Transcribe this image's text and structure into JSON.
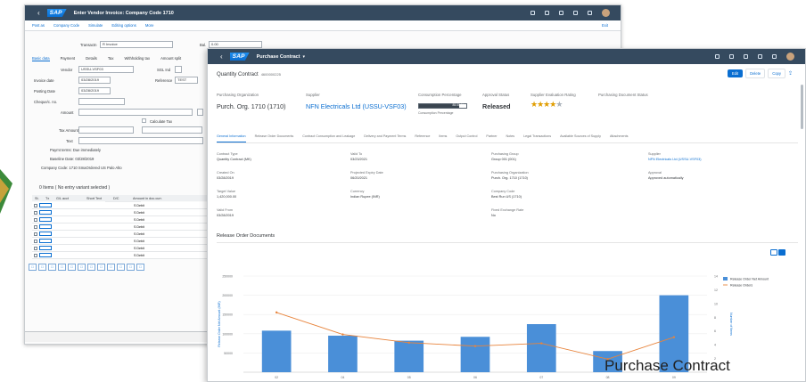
{
  "back_window": {
    "title": "Enter Vendor Invoice: Company Code 1710",
    "menu": [
      "Post as",
      "Company Code",
      "Simulate",
      "Editing options",
      "More"
    ],
    "exit_label": "Exit",
    "transaction_label": "Transactn",
    "transaction_value": "R Invoice",
    "bal_label": "Bal.",
    "bal_value": "0.00",
    "tabs": [
      "Basic data",
      "Payment",
      "Details",
      "Tax",
      "Withholding tax",
      "Amount split"
    ],
    "fields": {
      "vendor_label": "Vendor",
      "vendor_value": "USSU-VSF03",
      "sgl_label": "SGL Ind",
      "invoice_date_label": "Invoice date",
      "invoice_date_value": "03/28/2019",
      "reference_label": "Reference",
      "reference_value": "TEST",
      "posting_date_label": "Posting Date",
      "posting_date_value": "03/28/2019",
      "cheque_label": "Cheque/c. no.",
      "amount_label": "Amount",
      "calculate_tax_label": "Calculate Tax",
      "tax_amount_label": "Tax Amount",
      "text_label": "Text",
      "payt_terms": "Paymt terms: Due immediately",
      "baseline_date": "Baseline Date: 03/28/2019",
      "company_code": "Company Code: 1710 SmaOrdered US Palo Alto"
    },
    "items_header": "0 Items ( No entry variant selected )",
    "grid_columns": [
      "St.",
      "Tx",
      "G/L acct",
      "Short Text",
      "D/C",
      "Amount in doc.curr."
    ],
    "grid_dc_value": "S Debit",
    "grid_rows": 8
  },
  "front_window": {
    "app_title": "Purchase Contract",
    "object_title": "Quantity Contract",
    "object_id": "4600000225",
    "buttons": {
      "edit": "Edit",
      "delete": "Delete",
      "copy": "Copy"
    },
    "kpis": {
      "purch_org_label": "Purchasing Organization",
      "purch_org_value": "Purch. Org. 1710 (1710)",
      "supplier_label": "Supplier",
      "supplier_value": "NFN Electricals Ltd (USSU-VSF03)",
      "consumption_label": "Consumption Percentage",
      "consumption_bar_text": "85.00 %",
      "consumption_sub": "Consumption Percentage",
      "consumption_percent": 85,
      "approval_label": "Approval Status",
      "approval_value": "Released",
      "rating_label": "Supplier Evaluation Rating",
      "rating_value": 4,
      "doc_status_label": "Purchasing Document Status"
    },
    "tabs": [
      "General Information",
      "Release Order Documents",
      "Contract Consumption and Leakage",
      "Delivery and Payment Terms",
      "Reference",
      "Items",
      "Output Control",
      "Partner",
      "Notes",
      "Legal Transactions",
      "Available Sources of Supply",
      "Attachments"
    ],
    "general_info": [
      {
        "label": "Contract Type",
        "value": "Quantity Contract (MK)"
      },
      {
        "label": "Valid To",
        "value": "03/23/2021"
      },
      {
        "label": "Purchasing Group",
        "value": "Group 001 (001)"
      },
      {
        "label": "Supplier",
        "value": "NFN Electricals Ltd (USSU-VSF03)"
      },
      {
        "label": "Created On",
        "value": "03/28/2019"
      },
      {
        "label": "Projected Expiry Date",
        "value": "06/20/2021"
      },
      {
        "label": "Purchasing Organization",
        "value": "Purch. Org. 1710 (1710)"
      },
      {
        "label": "Approval",
        "value": "Approved automatically"
      },
      {
        "label": "Target Value",
        "value": "1,420,000.00"
      },
      {
        "label": "Currency",
        "value": "Indian Rupee (INR)"
      },
      {
        "label": "Company Code",
        "value": "Best Run US (1710)"
      },
      {
        "label": "Valid From",
        "value": "03/28/2019"
      },
      {
        "label": "Fixed Exchange Rate",
        "value": "No"
      }
    ],
    "release_section_title": "Release Order Documents"
  },
  "caption": "Purchase Contract",
  "chart_data": {
    "type": "bar",
    "categories": [
      "02",
      "04",
      "05",
      "06",
      "07",
      "08",
      "09"
    ],
    "series": [
      {
        "name": "Release Order Net Amount",
        "type": "bar",
        "values": [
          108000,
          95000,
          82000,
          92000,
          125000,
          55000,
          200000
        ]
      },
      {
        "name": "Release Orders",
        "type": "line",
        "values": [
          8.7,
          5.5,
          4.3,
          3.8,
          4.2,
          1.9,
          5.1
        ]
      }
    ],
    "ylim": [
      0,
      250000
    ],
    "y2lim": [
      0,
      14
    ],
    "yticks": [
      "250000",
      "200000",
      "150000",
      "100000",
      "50000"
    ],
    "y2ticks": [
      "14",
      "12",
      "10",
      "8",
      "6",
      "4",
      "2"
    ],
    "ylabel": "Release Order Net Amount (INR)",
    "y2label": "Number of Items",
    "colors": {
      "bar": "#4a8fd8",
      "line": "#e8843c"
    }
  }
}
